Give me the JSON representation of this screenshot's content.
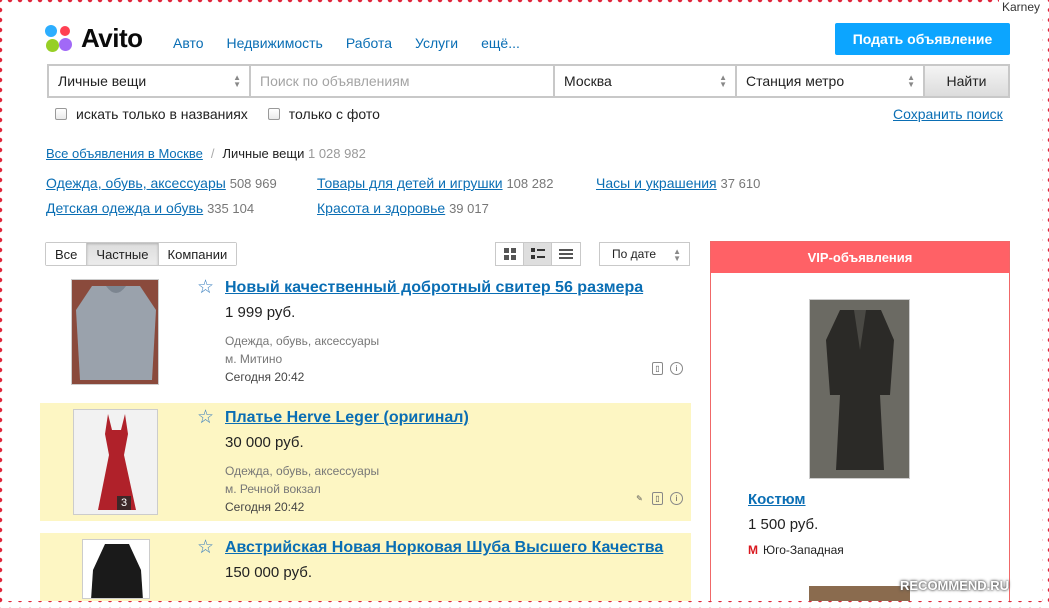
{
  "watermark_user": "Karney",
  "logo": {
    "text": "Avito"
  },
  "topnav": [
    "Авто",
    "Недвижимость",
    "Работа",
    "Услуги",
    "ещё..."
  ],
  "post_button": "Подать объявление",
  "search": {
    "category": "Личные вещи",
    "query_placeholder": "Поиск по объявлениям",
    "city": "Москва",
    "metro": "Станция метро",
    "submit": "Найти"
  },
  "filters": {
    "titles_only": "искать только в названиях",
    "with_photo": "только с фото",
    "save_search": "Сохранить поиск"
  },
  "breadcrumb": {
    "root": "Все объявления в Москве",
    "sep": "/",
    "current": "Личные вещи",
    "count": "1 028 982"
  },
  "categories": [
    {
      "name": "Одежда, обувь, аксессуары",
      "count": "508 969"
    },
    {
      "name": "Детская одежда и обувь",
      "count": "335 104"
    },
    {
      "name": "Товары для детей и игрушки",
      "count": "108 282"
    },
    {
      "name": "Красота и здоровье",
      "count": "39 017"
    },
    {
      "name": "Часы и украшения",
      "count": "37 610"
    }
  ],
  "seller_tabs": [
    "Все",
    "Частные",
    "Компании"
  ],
  "sort": "По дате",
  "listings": [
    {
      "title": "Новый качественный добротный свитер 56 размера",
      "price": "1 999 руб.",
      "category": "Одежда, обувь, аксессуары",
      "location": "м. Митино",
      "date": "Сегодня 20:42"
    },
    {
      "title": "Платье Herve Leger (оригинал)",
      "price": "30 000 руб.",
      "category": "Одежда, обувь, аксессуары",
      "location": "м. Речной вокзал",
      "date": "Сегодня 20:42",
      "photos": "3"
    },
    {
      "title": "Австрийская Новая Норковая Шуба Высшего Качества",
      "price": "150 000 руб."
    }
  ],
  "vip": {
    "header": "VIP-объявления",
    "title": "Костюм",
    "price": "1 500 руб.",
    "metro": "Юго-Западная"
  },
  "recommend_watermark": "RECOMMEND.RU",
  "colors": {
    "link": "#0a6eb4",
    "post_button": "#0ca5ff",
    "vip_header": "#ff6166",
    "highlight": "#fdf6c3"
  }
}
